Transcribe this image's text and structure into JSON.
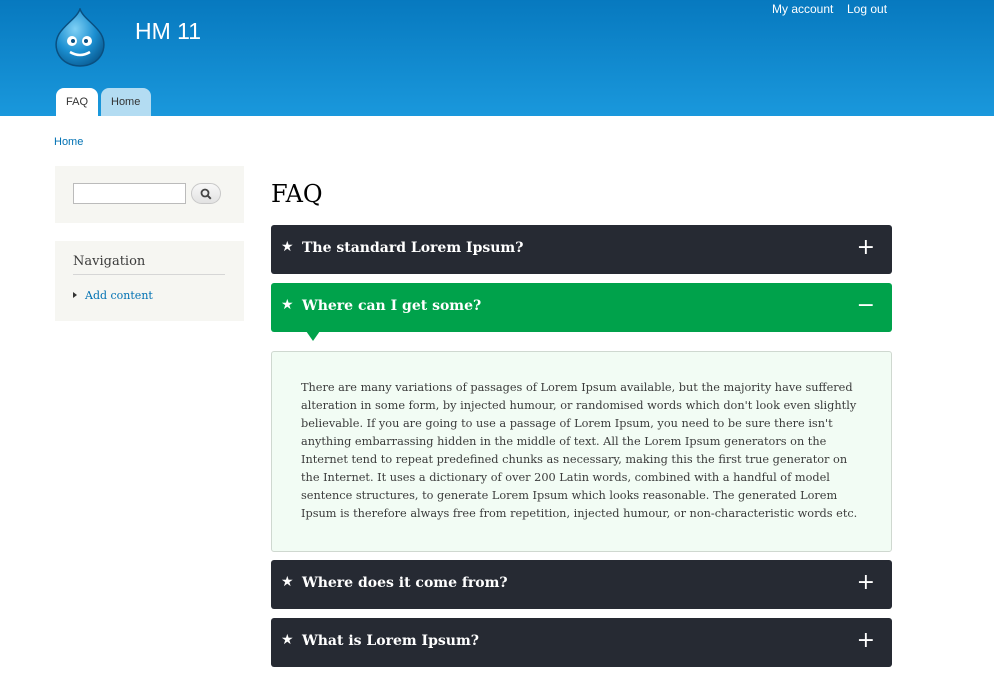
{
  "site": {
    "name": "HM 11"
  },
  "user_menu": {
    "my_account": "My account",
    "log_out": "Log out"
  },
  "tabs": [
    {
      "label": "FAQ",
      "active": true
    },
    {
      "label": "Home",
      "active": false
    }
  ],
  "breadcrumb": {
    "home": "Home"
  },
  "sidebar": {
    "search": {
      "value": "",
      "icon": "search-icon"
    },
    "navigation": {
      "title": "Navigation",
      "items": [
        {
          "label": "Add content"
        }
      ]
    }
  },
  "page": {
    "title": "FAQ"
  },
  "faq": [
    {
      "question": "The standard Lorem Ipsum?",
      "toggle": "+",
      "expanded": false
    },
    {
      "question": "Where can I get some?",
      "toggle": "−",
      "expanded": true,
      "answer": "There are many variations of passages of Lorem Ipsum available, but the majority have suffered alteration in some form, by injected humour, or randomised words which don't look even slightly believable. If you are going to use a passage of Lorem Ipsum, you need to be sure there isn't anything embarrassing hidden in the middle of text. All the Lorem Ipsum generators on the Internet tend to repeat predefined chunks as necessary, making this the first true generator on the Internet. It uses a dictionary of over 200 Latin words, combined with a handful of model sentence structures, to generate Lorem Ipsum which looks reasonable. The generated Lorem Ipsum is therefore always free from repetition, injected humour, or non-characteristic words etc."
    },
    {
      "question": "Where does it come from?",
      "toggle": "+",
      "expanded": false
    },
    {
      "question": "What is Lorem Ipsum?",
      "toggle": "+",
      "expanded": false
    }
  ],
  "icons": {
    "star": "★"
  },
  "colors": {
    "header_top": "#0779bf",
    "header_bottom": "#1a98dc",
    "faq_collapsed": "#262a33",
    "faq_expanded": "#00a24b",
    "answer_bg": "#f2fcf4",
    "link": "#0071b3"
  }
}
